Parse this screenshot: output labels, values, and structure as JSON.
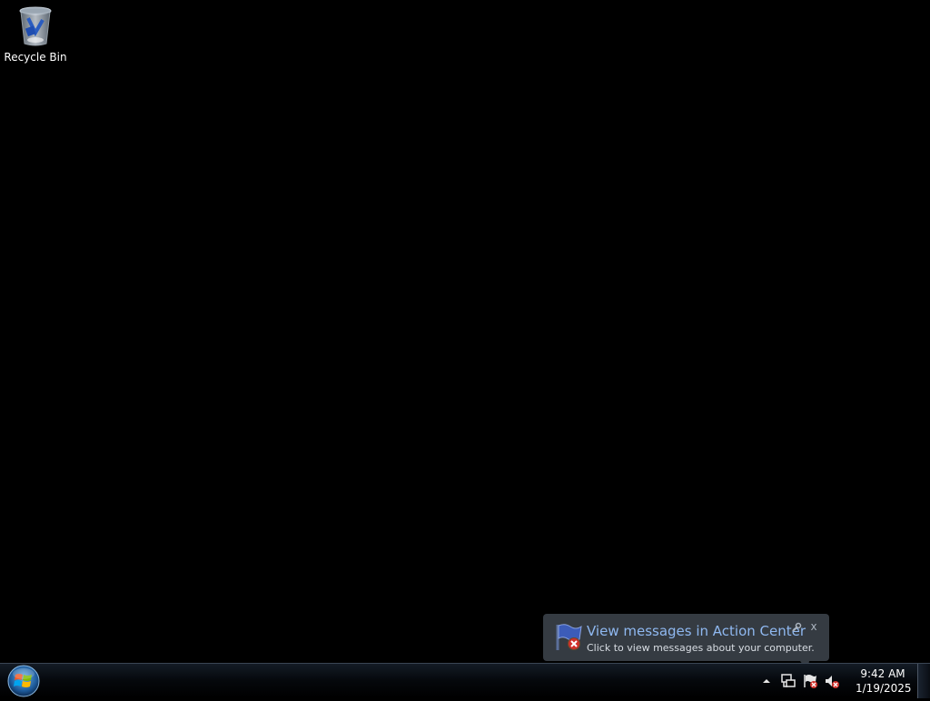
{
  "desktop": {
    "icons": [
      {
        "label": "Recycle Bin",
        "icon": "recycle-bin-icon"
      }
    ]
  },
  "notification": {
    "title": "View messages in Action Center",
    "text": "Click to view messages about your computer.",
    "icon": "action-center-flag-error-icon",
    "close_label": "x"
  },
  "taskbar": {
    "start_icon": "windows-start-orb-icon",
    "tray": {
      "items": [
        {
          "name": "show-hidden-icons",
          "icon": "up-arrow-icon"
        },
        {
          "name": "network",
          "icon": "network-icon"
        },
        {
          "name": "action-center",
          "icon": "action-center-flag-error-icon"
        },
        {
          "name": "volume",
          "icon": "volume-muted-error-icon"
        }
      ],
      "clock": {
        "time": "9:42 AM",
        "date": "1/19/2025"
      }
    }
  },
  "colors": {
    "desktop_bg": "#000000",
    "balloon_title": "#8fb8f0",
    "error_red": "#d0302a"
  }
}
